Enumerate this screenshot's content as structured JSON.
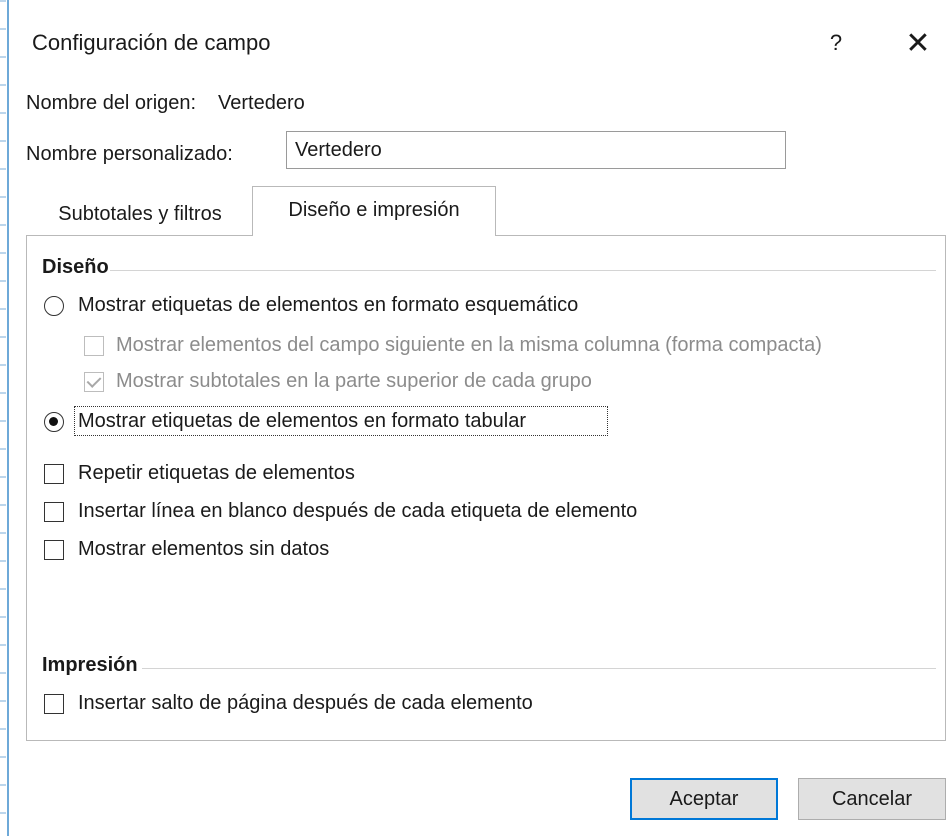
{
  "window": {
    "title": "Configuración de campo",
    "help_label": "?",
    "close_label": "✕"
  },
  "source": {
    "label": "Nombre del origen:",
    "value": "Vertedero"
  },
  "custom": {
    "label": "Nombre personalizado:",
    "value": "Vertedero"
  },
  "tabs": [
    {
      "label": "Subtotales y filtros",
      "selected": false
    },
    {
      "label": "Diseño e impresión",
      "selected": true
    }
  ],
  "layout_section": {
    "heading": "Diseño",
    "options": [
      {
        "label": "Mostrar etiquetas de elementos en formato esquemático",
        "type": "radio",
        "checked": false,
        "enabled": true
      },
      {
        "label": "Mostrar elementos del campo siguiente en la misma columna (forma compacta)",
        "type": "checkbox",
        "checked": false,
        "enabled": false
      },
      {
        "label": "Mostrar subtotales en la parte superior de cada grupo",
        "type": "checkbox",
        "checked": true,
        "enabled": false
      },
      {
        "label": "Mostrar etiquetas de elementos en formato tabular",
        "type": "radio",
        "checked": true,
        "enabled": true
      },
      {
        "label": "Repetir etiquetas de elementos",
        "type": "checkbox",
        "checked": false,
        "enabled": true
      },
      {
        "label": "Insertar línea en blanco después de cada etiqueta de elemento",
        "type": "checkbox",
        "checked": false,
        "enabled": true
      },
      {
        "label": "Mostrar elementos sin datos",
        "type": "checkbox",
        "checked": false,
        "enabled": true
      }
    ]
  },
  "print_section": {
    "heading": "Impresión",
    "options": [
      {
        "label": "Insertar salto de página después de cada elemento",
        "type": "checkbox",
        "checked": false,
        "enabled": true
      }
    ]
  },
  "buttons": {
    "ok": "Aceptar",
    "cancel": "Cancelar"
  }
}
